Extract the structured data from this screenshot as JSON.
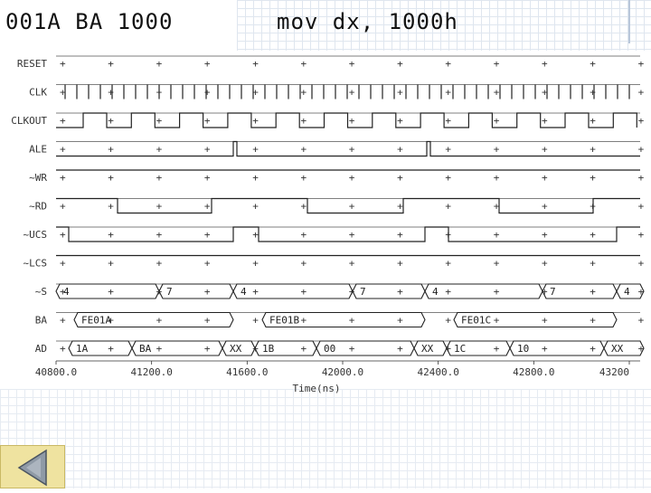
{
  "header": {
    "left_text": "001A BA 1000",
    "right_text": "mov dx, 1000h"
  },
  "diagram": {
    "x_axis_label": "Time(ns)",
    "x_ticks": [
      "40800.0",
      "41200.0",
      "41600.0",
      "42000.0",
      "42400.0",
      "42800.0",
      "43200"
    ],
    "signals": [
      {
        "id": "RESET",
        "label": "RESET"
      },
      {
        "id": "CLK",
        "label": "CLK"
      },
      {
        "id": "CLKOUT",
        "label": "CLKOUT"
      },
      {
        "id": "ALE",
        "label": "ALE"
      },
      {
        "id": "WR",
        "label": "~WR"
      },
      {
        "id": "RD",
        "label": "~RD"
      },
      {
        "id": "UCS",
        "label": "~UCS"
      },
      {
        "id": "LCS",
        "label": "~LCS"
      },
      {
        "id": "S",
        "label": "~S"
      },
      {
        "id": "BA",
        "label": "BA"
      },
      {
        "id": "AD",
        "label": "AD"
      }
    ],
    "bus_values": {
      "S": [
        "4",
        "7",
        "4",
        "7",
        "4",
        "7",
        "4"
      ],
      "BA": [
        "FE01A",
        "FE01B",
        "FE01C"
      ],
      "AD": [
        "1A",
        "BA",
        "XX",
        "1B",
        "00",
        "XX",
        "1C",
        "10",
        "XX"
      ]
    }
  },
  "nav": {
    "icon": "left-triangle-icon"
  }
}
